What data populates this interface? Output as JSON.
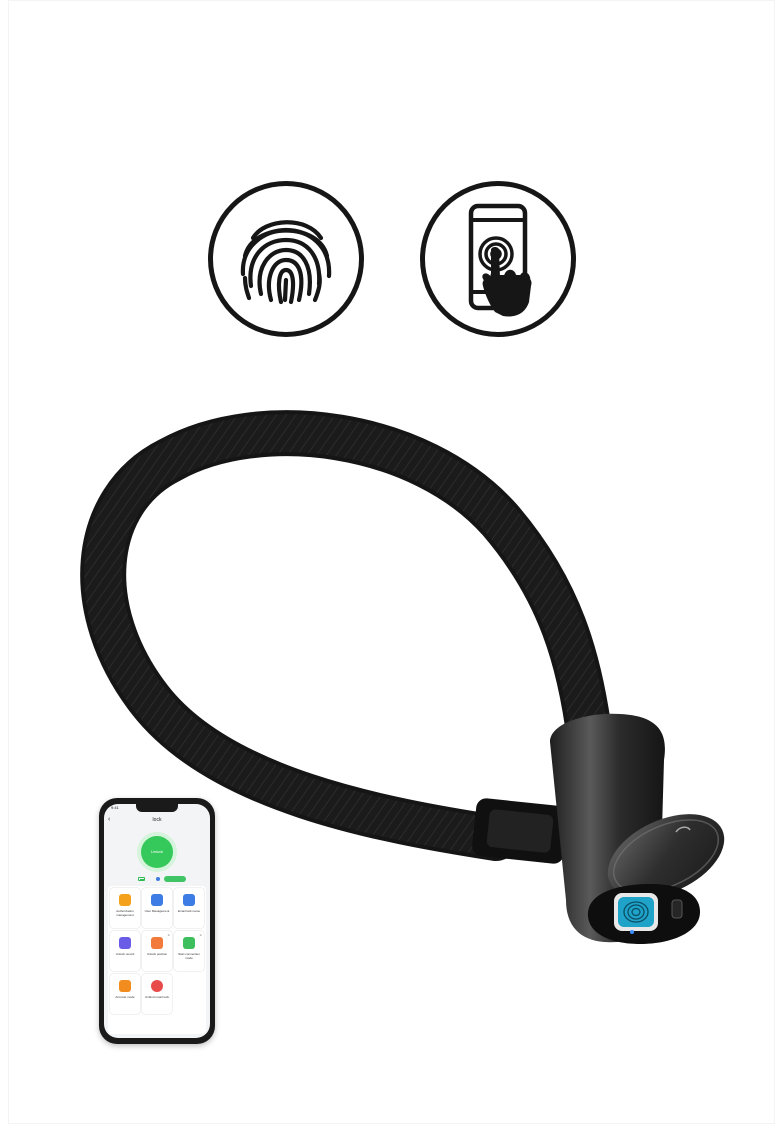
{
  "icons": {
    "fingerprint": "fingerprint-icon",
    "phone_touch": "phone-touch-icon"
  },
  "phone_app": {
    "status_time": "9:41",
    "title": "lock",
    "unlock_label": "Unlock",
    "tiles": [
      {
        "label": "Authorization management",
        "icon": "user-key-icon",
        "color": "#f4a21d",
        "badge": ""
      },
      {
        "label": "User Management",
        "icon": "user-settings-icon",
        "color": "#3d7be5",
        "badge": ""
      },
      {
        "label": "Email lock name",
        "icon": "card-icon",
        "color": "#3d7be5",
        "badge": ""
      },
      {
        "label": "Unlock record",
        "icon": "document-icon",
        "color": "#6b5ce7",
        "badge": ""
      },
      {
        "label": "Unlock position",
        "icon": "location-pin-icon",
        "color": "#f27a3b",
        "badge": "⊕"
      },
      {
        "label": "Start connection mode",
        "icon": "share-icon",
        "color": "#3cbf5c",
        "badge": "⊕"
      },
      {
        "label": "Anti-lost mode",
        "icon": "shield-icon",
        "color": "#f28c1f",
        "badge": ""
      },
      {
        "label": "Unbind smart lock",
        "icon": "unlink-icon",
        "color": "#e84a4a",
        "badge": ""
      }
    ]
  },
  "colors": {
    "cable": "#1c1c1c",
    "lock_body": "#3b3b3b",
    "fingerprint_sensor": "#1fa3c9",
    "app_accent": "#35c85a"
  }
}
